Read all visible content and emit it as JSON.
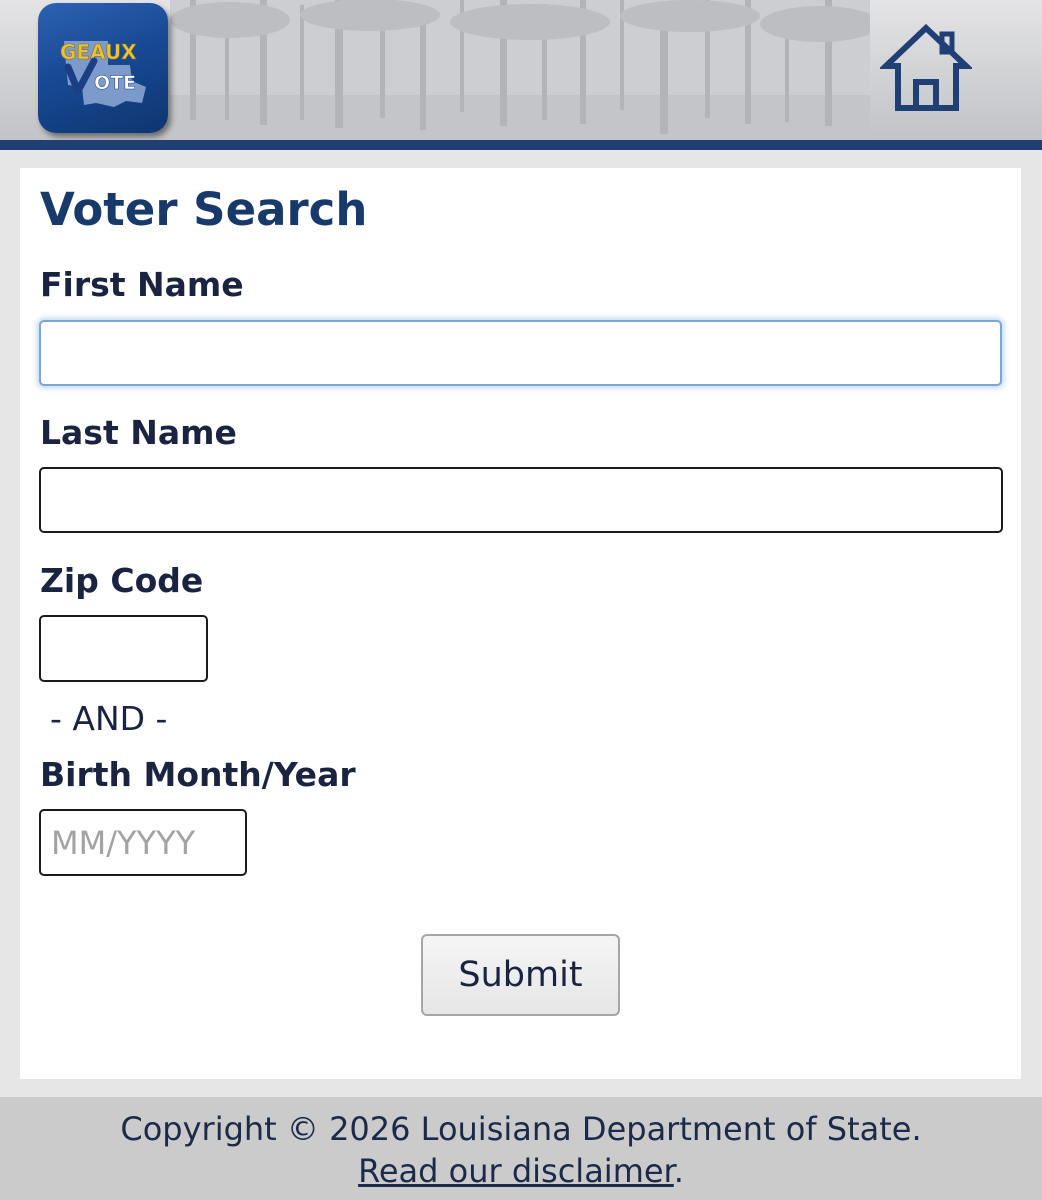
{
  "logo": {
    "line1": "GEAUX",
    "line2": "VOTE",
    "icon": "geaux-vote-logo"
  },
  "header": {
    "home_icon": "home-icon",
    "accent_color": "#1f3f75"
  },
  "form": {
    "title": "Voter Search",
    "first_name_label": "First Name",
    "first_name_value": "",
    "last_name_label": "Last Name",
    "last_name_value": "",
    "zip_label": "Zip Code",
    "zip_value": "",
    "and_separator": "- AND -",
    "birth_label": "Birth Month/Year",
    "birth_placeholder": "MM/YYYY",
    "submit_label": "Submit"
  },
  "footer": {
    "copyright": "Copyright © 2026 Louisiana Department of State.",
    "disclaimer_link": "Read our disclaimer",
    "disclaimer_suffix": "."
  },
  "colors": {
    "title": "#183a6b",
    "header_bar": "#1f3f75",
    "logo_gold": "#e8c23a"
  }
}
